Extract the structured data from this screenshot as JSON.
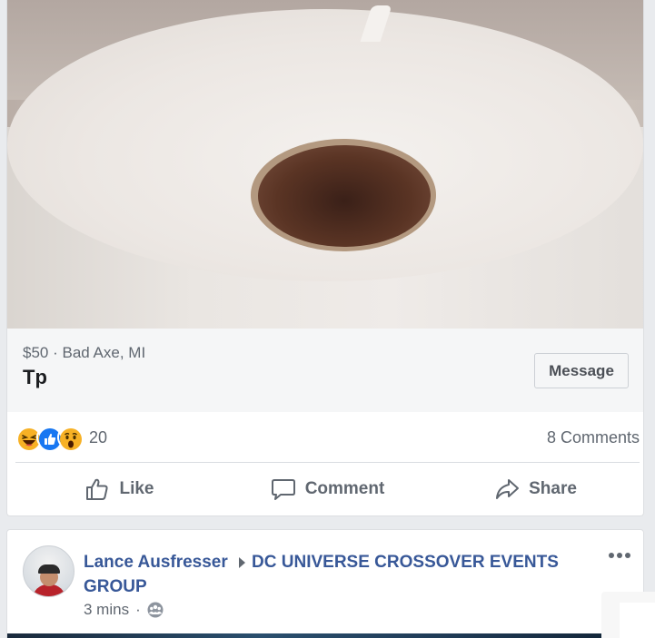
{
  "listing": {
    "price": "$50",
    "separator": "·",
    "location": "Bad Axe, MI",
    "title": "Tp",
    "message_label": "Message"
  },
  "engagement": {
    "reaction_icons": [
      "haha-icon",
      "like-icon",
      "wow-icon"
    ],
    "reaction_count": "20",
    "comments": "8 Comments"
  },
  "actions": {
    "like": "Like",
    "comment": "Comment",
    "share": "Share"
  },
  "post2": {
    "author": "Lance Ausfresser",
    "group": "DC UNIVERSE CROSSOVER EVENTS GROUP",
    "time": "3 mins",
    "separator": "·",
    "audience_icon": "group-icon"
  },
  "colors": {
    "link_blue": "#385898",
    "secondary_text": "#606770",
    "background": "#e9ebee",
    "like_blue": "#1877f2",
    "reaction_yellow": "#f7b125"
  }
}
